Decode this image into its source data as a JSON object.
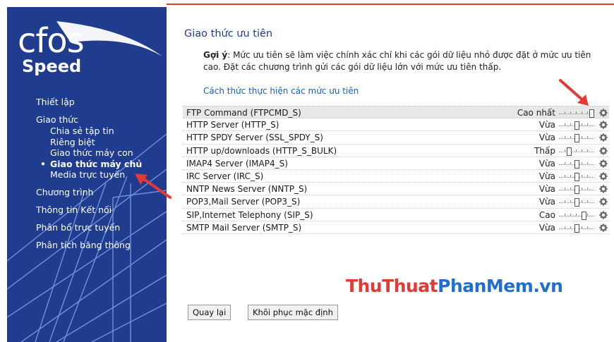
{
  "sidebar": {
    "logo_top": "cfos",
    "logo_bottom": "Speed",
    "nav": {
      "setup": "Thiết lập",
      "protocols": "Giao thức",
      "sub_items": [
        "Chia sẻ tập tin",
        "Riêng biệt",
        "Giao thức máy con",
        "Giao thức máy chủ",
        "Media trực tuyến"
      ],
      "active_index": 3,
      "programs": "Chương trình",
      "connection_info": "Thông tin Kết nối",
      "online_distribution": "Phân bổ trực tuyến",
      "bandwidth_analysis": "Phân tích băng thông"
    }
  },
  "main": {
    "title": "Giao thức ưu tiên",
    "hint_label": "Gợi ý",
    "hint_text": ": Mức ưu tiên sẽ làm việc chính xác chỉ khi các gói dữ liệu nhỏ được đặt ở mức ưu tiên cao. Đặt các chương trình gửi các gói dữ liệu lớn với mức ưu tiên thấp.",
    "howto_link": "Cách thức thực hiện các mức ưu tiên",
    "protocols": [
      {
        "name": "FTP Command (FTPCMD_S)",
        "level": "Cao nhất",
        "slider_position": 1.0
      },
      {
        "name": "HTTP Server (HTTP_S)",
        "level": "Vừa",
        "slider_position": 0.5
      },
      {
        "name": "HTTP SPDY Server (SSL_SPDY_S)",
        "level": "Vừa",
        "slider_position": 0.5
      },
      {
        "name": "HTTP up/downloads (HTTP_S_BULK)",
        "level": "Thấp",
        "slider_position": 0.25
      },
      {
        "name": "IMAP4 Server (IMAP4_S)",
        "level": "Vừa",
        "slider_position": 0.5
      },
      {
        "name": "IRC Server (IRC_S)",
        "level": "Vừa",
        "slider_position": 0.5
      },
      {
        "name": "NNTP News Server (NNTP_S)",
        "level": "Vừa",
        "slider_position": 0.5
      },
      {
        "name": "POP3,Mail Server (POP3_S)",
        "level": "Vừa",
        "slider_position": 0.5
      },
      {
        "name": "SIP,Internet Telephony (SIP_S)",
        "level": "Cao",
        "slider_position": 0.75
      },
      {
        "name": "SMTP Mail Server (SMTP_S)",
        "level": "Vừa",
        "slider_position": 0.5
      }
    ],
    "back_button": "Quay lại",
    "restore_button": "Khôi phục mặc định"
  },
  "watermark": {
    "part1": "Thu",
    "part2": "Thuat",
    "part3": "PhanMem",
    "part4": ".vn"
  },
  "icons": {
    "settings": "gear-icon",
    "annotation": "red-arrow-icon"
  },
  "colors": {
    "sidebar_bg": "#1f3c8f",
    "title": "#1f3c8f",
    "link": "#1a5fb4",
    "arrow": "#e53935"
  }
}
